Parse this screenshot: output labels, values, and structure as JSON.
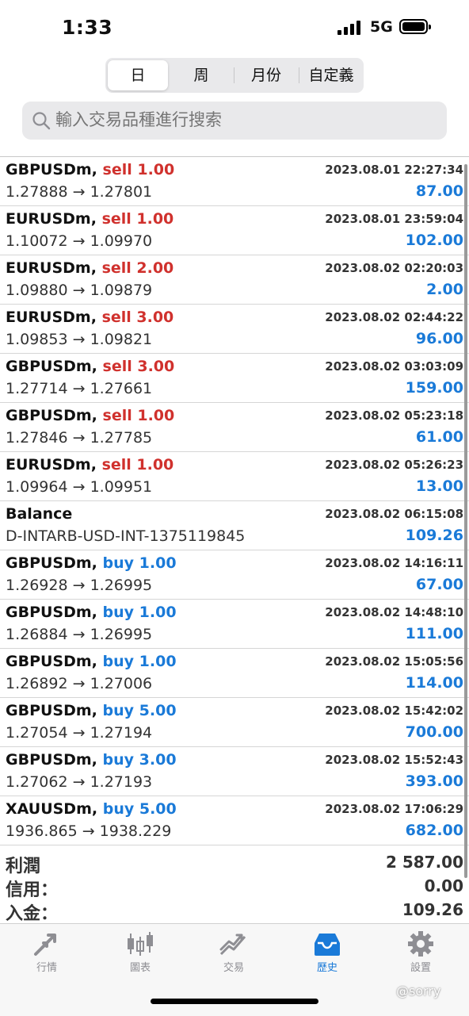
{
  "status_bar": {
    "time": "1:33",
    "network": "5G"
  },
  "period_tabs": [
    {
      "label": "日",
      "active": true
    },
    {
      "label": "周",
      "active": false
    },
    {
      "label": "月份",
      "active": false
    },
    {
      "label": "自定義",
      "active": false
    }
  ],
  "search": {
    "placeholder": "輸入交易品種進行搜索",
    "icon": "search-icon"
  },
  "colors": {
    "sell": "#d0312d",
    "buy": "#1a7ad8",
    "profit": "#1a7ad8",
    "active_tab": "#1a7ad8"
  },
  "trades": [
    {
      "symbol": "GBPUSDm,",
      "side": "sell 1.00",
      "side_type": "sell",
      "datetime": "2023.08.01 22:27:34",
      "prices": "1.27888 → 1.27801",
      "profit": "87.00"
    },
    {
      "symbol": "EURUSDm,",
      "side": "sell 1.00",
      "side_type": "sell",
      "datetime": "2023.08.01 23:59:04",
      "prices": "1.10072 → 1.09970",
      "profit": "102.00"
    },
    {
      "symbol": "EURUSDm,",
      "side": "sell 2.00",
      "side_type": "sell",
      "datetime": "2023.08.02 02:20:03",
      "prices": "1.09880 → 1.09879",
      "profit": "2.00"
    },
    {
      "symbol": "EURUSDm,",
      "side": "sell 3.00",
      "side_type": "sell",
      "datetime": "2023.08.02 02:44:22",
      "prices": "1.09853 → 1.09821",
      "profit": "96.00"
    },
    {
      "symbol": "GBPUSDm,",
      "side": "sell 3.00",
      "side_type": "sell",
      "datetime": "2023.08.02 03:03:09",
      "prices": "1.27714 → 1.27661",
      "profit": "159.00"
    },
    {
      "symbol": "GBPUSDm,",
      "side": "sell 1.00",
      "side_type": "sell",
      "datetime": "2023.08.02 05:23:18",
      "prices": "1.27846 → 1.27785",
      "profit": "61.00"
    },
    {
      "symbol": "EURUSDm,",
      "side": "sell 1.00",
      "side_type": "sell",
      "datetime": "2023.08.02 05:26:23",
      "prices": "1.09964 → 1.09951",
      "profit": "13.00"
    },
    {
      "symbol": "Balance",
      "side": "",
      "side_type": "none",
      "datetime": "2023.08.02 06:15:08",
      "prices": "D-INTARB-USD-INT-1375119845",
      "profit": "109.26"
    },
    {
      "symbol": "GBPUSDm,",
      "side": "buy 1.00",
      "side_type": "buy",
      "datetime": "2023.08.02 14:16:11",
      "prices": "1.26928 → 1.26995",
      "profit": "67.00"
    },
    {
      "symbol": "GBPUSDm,",
      "side": "buy 1.00",
      "side_type": "buy",
      "datetime": "2023.08.02 14:48:10",
      "prices": "1.26884 → 1.26995",
      "profit": "111.00"
    },
    {
      "symbol": "GBPUSDm,",
      "side": "buy 1.00",
      "side_type": "buy",
      "datetime": "2023.08.02 15:05:56",
      "prices": "1.26892 → 1.27006",
      "profit": "114.00"
    },
    {
      "symbol": "GBPUSDm,",
      "side": "buy 5.00",
      "side_type": "buy",
      "datetime": "2023.08.02 15:42:02",
      "prices": "1.27054 → 1.27194",
      "profit": "700.00"
    },
    {
      "symbol": "GBPUSDm,",
      "side": "buy 3.00",
      "side_type": "buy",
      "datetime": "2023.08.02 15:52:43",
      "prices": "1.27062 → 1.27193",
      "profit": "393.00"
    },
    {
      "symbol": "XAUUSDm,",
      "side": "buy 5.00",
      "side_type": "buy",
      "datetime": "2023.08.02 17:06:29",
      "prices": "1936.865 → 1938.229",
      "profit": "682.00"
    }
  ],
  "summary": [
    {
      "label": "利潤",
      "value": "2 587.00"
    },
    {
      "label": "信用：",
      "value": "0.00"
    },
    {
      "label": "入金：",
      "value": "109.26"
    }
  ],
  "tabbar": [
    {
      "label": "行情",
      "icon": "quotes-arrows-icon",
      "active": false
    },
    {
      "label": "圖表",
      "icon": "candlestick-chart-icon",
      "active": false
    },
    {
      "label": "交易",
      "icon": "trade-chart-icon",
      "active": false
    },
    {
      "label": "歷史",
      "icon": "history-tray-icon",
      "active": true
    },
    {
      "label": "設置",
      "icon": "gear-icon",
      "active": false
    }
  ],
  "watermark": "@sorry"
}
